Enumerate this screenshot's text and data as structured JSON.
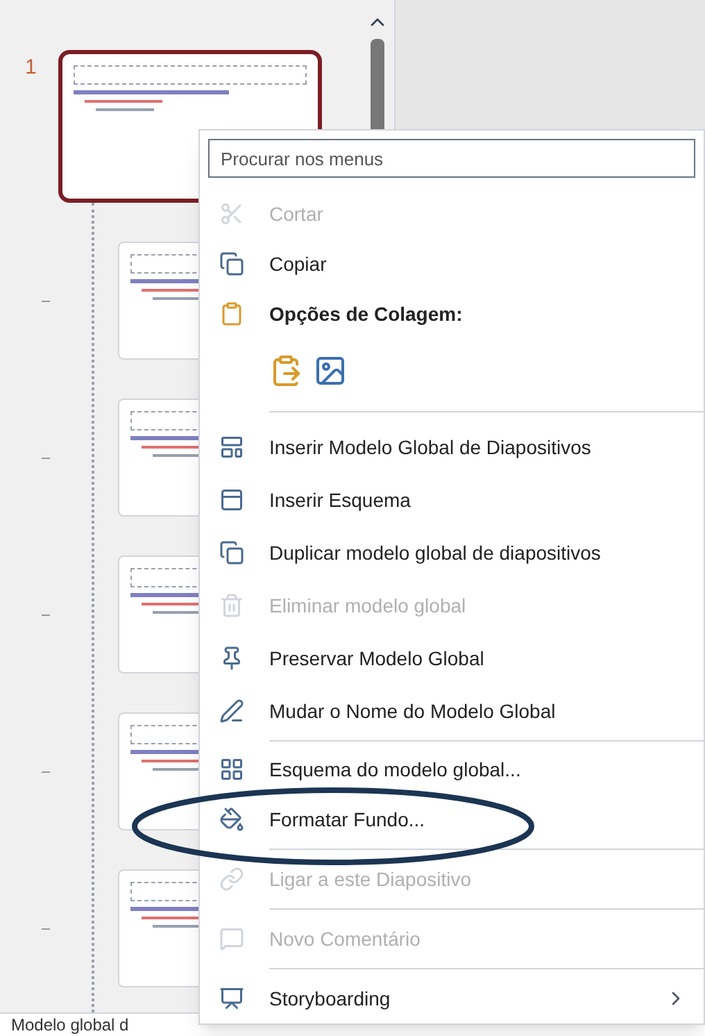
{
  "slide_panel": {
    "slide_number": "1",
    "thumbnails": [
      {
        "selected": true
      },
      {
        "selected": false
      },
      {
        "selected": false
      },
      {
        "selected": false
      },
      {
        "selected": false
      },
      {
        "selected": false
      }
    ]
  },
  "context_menu": {
    "search": {
      "placeholder": "Procurar nos menus"
    },
    "items": [
      {
        "kind": "item",
        "label": "Cortar",
        "disabled": true
      },
      {
        "kind": "item",
        "label": "Copiar",
        "disabled": false
      },
      {
        "kind": "header",
        "label": "Opções de Colagem:"
      },
      {
        "kind": "paste"
      },
      {
        "kind": "separator"
      },
      {
        "kind": "item",
        "label": "Inserir Modelo Global de Diapositivos",
        "disabled": false
      },
      {
        "kind": "item",
        "label": "Inserir Esquema",
        "disabled": false
      },
      {
        "kind": "item",
        "label": "Duplicar modelo global de diapositivos",
        "disabled": false
      },
      {
        "kind": "item",
        "label": "Eliminar modelo global",
        "disabled": true
      },
      {
        "kind": "item",
        "label": "Preservar Modelo Global",
        "disabled": false
      },
      {
        "kind": "item",
        "label": "Mudar o Nome do Modelo Global",
        "disabled": false
      },
      {
        "kind": "separator"
      },
      {
        "kind": "item",
        "label": "Esquema do modelo global...",
        "disabled": false
      },
      {
        "kind": "item",
        "label": "Formatar Fundo...",
        "disabled": false
      },
      {
        "kind": "separator"
      },
      {
        "kind": "item",
        "label": "Ligar a este Diapositivo",
        "disabled": true
      },
      {
        "kind": "separator"
      },
      {
        "kind": "item",
        "label": "Novo Comentário",
        "disabled": true
      },
      {
        "kind": "separator"
      },
      {
        "kind": "submenu",
        "label": "Storyboarding",
        "disabled": false
      }
    ]
  },
  "status_bar": {
    "text": "Modelo global d"
  }
}
